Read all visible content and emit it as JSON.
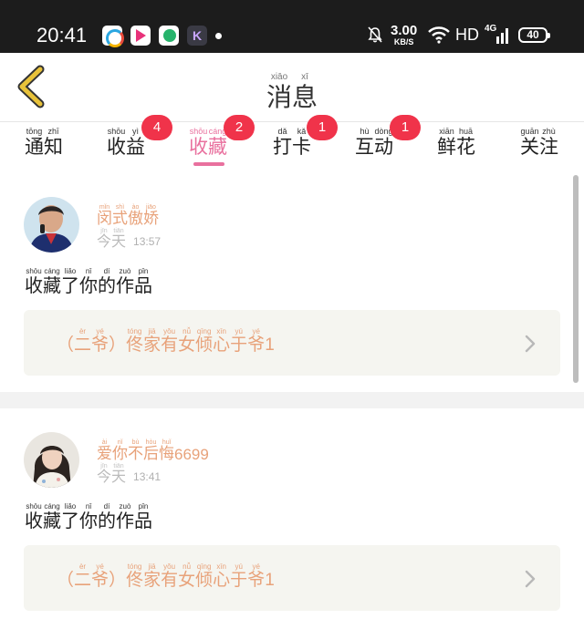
{
  "status_bar": {
    "time": "20:41",
    "app_k_label": "K",
    "net_speed_value": "3.00",
    "net_speed_unit": "KB/S",
    "hd": "HD",
    "network_type": "4G",
    "battery": "40"
  },
  "header": {
    "title": [
      {
        "py": "xiāo",
        "hz": "消"
      },
      {
        "py": "xī",
        "hz": "息"
      }
    ]
  },
  "tabs": [
    {
      "chars": [
        {
          "py": "tōng",
          "hz": "通"
        },
        {
          "py": "zhī",
          "hz": "知"
        }
      ],
      "badge": ""
    },
    {
      "chars": [
        {
          "py": "shōu",
          "hz": "收"
        },
        {
          "py": "yì",
          "hz": "益"
        }
      ],
      "badge": "4"
    },
    {
      "chars": [
        {
          "py": "shōu",
          "hz": "收"
        },
        {
          "py": "cáng",
          "hz": "藏"
        }
      ],
      "badge": "2",
      "active": true
    },
    {
      "chars": [
        {
          "py": "dǎ",
          "hz": "打"
        },
        {
          "py": "kǎ",
          "hz": "卡"
        }
      ],
      "badge": "1"
    },
    {
      "chars": [
        {
          "py": "hù",
          "hz": "互"
        },
        {
          "py": "dòng",
          "hz": "动"
        }
      ],
      "badge": "1"
    },
    {
      "chars": [
        {
          "py": "xiān",
          "hz": "鲜"
        },
        {
          "py": "huā",
          "hz": "花"
        }
      ],
      "badge": ""
    },
    {
      "chars": [
        {
          "py": "guān",
          "hz": "关"
        },
        {
          "py": "zhù",
          "hz": "注"
        }
      ],
      "badge": ""
    }
  ],
  "messages": [
    {
      "user": [
        {
          "py": "mǐn",
          "hz": "闵"
        },
        {
          "py": "shì",
          "hz": "式"
        },
        {
          "py": "ào",
          "hz": "傲"
        },
        {
          "py": "jiāo",
          "hz": "娇"
        }
      ],
      "user_suffix": "",
      "day": [
        {
          "py": "jīn",
          "hz": "今"
        },
        {
          "py": "tiān",
          "hz": "天"
        }
      ],
      "time": "13:57",
      "action": [
        {
          "py": "shōu",
          "hz": "收"
        },
        {
          "py": "cáng",
          "hz": "藏"
        },
        {
          "py": "liǎo",
          "hz": "了"
        },
        {
          "py": "nǐ",
          "hz": "你"
        },
        {
          "py": "dí",
          "hz": "的"
        },
        {
          "py": "zuò",
          "hz": "作"
        },
        {
          "py": "pǐn",
          "hz": "品"
        }
      ],
      "work": [
        {
          "py": "",
          "hz": "（"
        },
        {
          "py": "èr",
          "hz": "二"
        },
        {
          "py": "yé",
          "hz": "爷"
        },
        {
          "py": "",
          "hz": "）"
        },
        {
          "py": "tóng",
          "hz": "佟"
        },
        {
          "py": "jiā",
          "hz": "家"
        },
        {
          "py": "yǒu",
          "hz": "有"
        },
        {
          "py": "nǚ",
          "hz": "女"
        },
        {
          "py": "qīng",
          "hz": "倾"
        },
        {
          "py": "xīn",
          "hz": "心"
        },
        {
          "py": "yú",
          "hz": "于"
        },
        {
          "py": "yé",
          "hz": "爷"
        }
      ],
      "work_suffix": "1"
    },
    {
      "user": [
        {
          "py": "ài",
          "hz": "爱"
        },
        {
          "py": "nǐ",
          "hz": "你"
        },
        {
          "py": "bù",
          "hz": "不"
        },
        {
          "py": "hòu",
          "hz": "后"
        },
        {
          "py": "huǐ",
          "hz": "悔"
        }
      ],
      "user_suffix": "6699",
      "day": [
        {
          "py": "jīn",
          "hz": "今"
        },
        {
          "py": "tiān",
          "hz": "天"
        }
      ],
      "time": "13:41",
      "action": [
        {
          "py": "shōu",
          "hz": "收"
        },
        {
          "py": "cáng",
          "hz": "藏"
        },
        {
          "py": "liǎo",
          "hz": "了"
        },
        {
          "py": "nǐ",
          "hz": "你"
        },
        {
          "py": "dí",
          "hz": "的"
        },
        {
          "py": "zuò",
          "hz": "作"
        },
        {
          "py": "pǐn",
          "hz": "品"
        }
      ],
      "work": [
        {
          "py": "",
          "hz": "（"
        },
        {
          "py": "èr",
          "hz": "二"
        },
        {
          "py": "yé",
          "hz": "爷"
        },
        {
          "py": "",
          "hz": "）"
        },
        {
          "py": "tóng",
          "hz": "佟"
        },
        {
          "py": "jiā",
          "hz": "家"
        },
        {
          "py": "yǒu",
          "hz": "有"
        },
        {
          "py": "nǚ",
          "hz": "女"
        },
        {
          "py": "qīng",
          "hz": "倾"
        },
        {
          "py": "xīn",
          "hz": "心"
        },
        {
          "py": "yú",
          "hz": "于"
        },
        {
          "py": "yé",
          "hz": "爷"
        }
      ],
      "work_suffix": "1"
    }
  ],
  "icons": {
    "back": "chevron-left-icon",
    "work_arrow": "chevron-right-icon",
    "mute": "bell-off-icon",
    "wifi": "wifi-icon",
    "signal": "signal-icon",
    "battery": "battery-icon"
  },
  "colors": {
    "accent_pink": "#e9709e",
    "badge_red": "#f0334a",
    "name_orange": "#e8a27a",
    "back_gold": "#e8c23a",
    "status_bar": "#1c1c1c",
    "work_box_bg": "#f5f5f0"
  }
}
